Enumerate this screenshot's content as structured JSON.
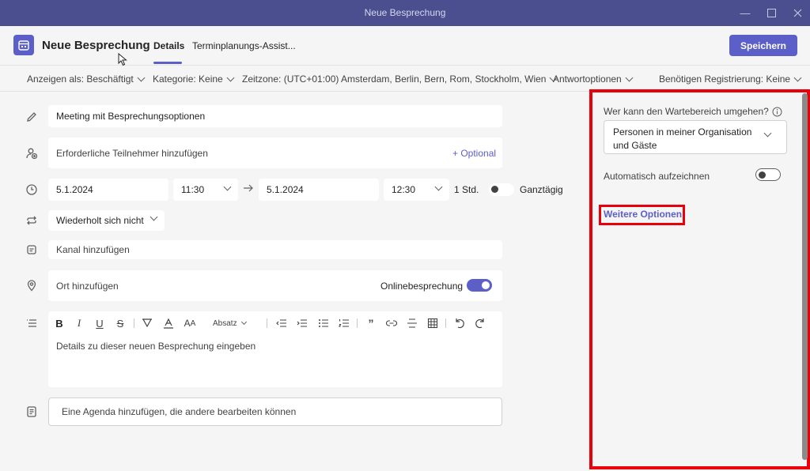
{
  "window": {
    "title": "Neue Besprechung",
    "controls": [
      "minimize",
      "maximize",
      "close"
    ]
  },
  "header": {
    "title": "Neue Besprechung",
    "tabs": [
      {
        "label": "Details",
        "active": true
      },
      {
        "label": "Terminplanungs-Assist...",
        "active": false
      }
    ],
    "save_label": "Speichern"
  },
  "options_bar": {
    "items": [
      "Anzeigen als: Beschäftigt",
      "Kategorie: Keine",
      "Zeitzone: (UTC+01:00) Amsterdam, Berlin, Bern, Rom, Stockholm, Wien",
      "Antwortoptionen",
      "Benötigen Registrierung: Keine"
    ]
  },
  "form": {
    "title_value": "Meeting mit Besprechungsoptionen",
    "attendees_placeholder": "Erforderliche Teilnehmer hinzufügen",
    "optional_label": "+ Optional",
    "start_date": "5.1.2024",
    "start_time": "11:30",
    "end_date": "5.1.2024",
    "end_time": "12:30",
    "duration": "1 Std.",
    "all_day_label": "Ganztägig",
    "repeat_value": "Wiederholt sich nicht",
    "channel_placeholder": "Kanal hinzufügen",
    "location_placeholder": "Ort hinzufügen",
    "online_meeting_label": "Onlinebesprechung",
    "paragraph_style": "Absatz",
    "details_placeholder": "Details zu dieser neuen Besprechung eingeben",
    "agenda_placeholder": "Eine Agenda hinzufügen, die andere bearbeiten können"
  },
  "panel": {
    "lobby_label": "Wer kann den Wartebereich umgehen?",
    "lobby_value": "Personen in meiner Organisation und Gäste",
    "record_label": "Automatisch aufzeichnen",
    "record_on": false,
    "more_options": "Weitere Optionen"
  },
  "colors": {
    "accent": "#5b5fc7",
    "titlebar": "#4b4f8f",
    "highlight": "#e8000b"
  }
}
